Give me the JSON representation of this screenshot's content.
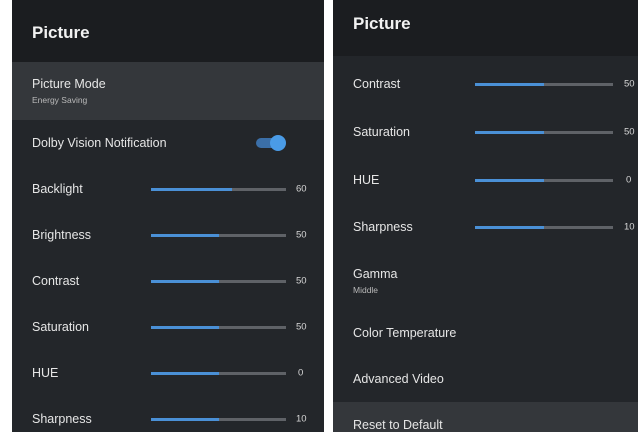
{
  "left": {
    "title": "Picture",
    "picture_mode": {
      "label": "Picture Mode",
      "value": "Energy Saving"
    },
    "dolby": {
      "label": "Dolby Vision Notification",
      "enabled": true
    },
    "sliders": [
      {
        "label": "Backlight",
        "value": "60",
        "level": 0.6
      },
      {
        "label": "Brightness",
        "value": "50",
        "level": 0.5
      },
      {
        "label": "Contrast",
        "value": "50",
        "level": 0.5
      },
      {
        "label": "Saturation",
        "value": "50",
        "level": 0.5
      },
      {
        "label": "HUE",
        "value": "0",
        "level": 0.5
      },
      {
        "label": "Sharpness",
        "value": "10",
        "level": 0.5
      }
    ]
  },
  "right": {
    "title": "Picture",
    "sliders": [
      {
        "label": "Contrast",
        "value": "50",
        "level": 0.5
      },
      {
        "label": "Saturation",
        "value": "50",
        "level": 0.5
      },
      {
        "label": "HUE",
        "value": "0",
        "level": 0.5
      },
      {
        "label": "Sharpness",
        "value": "10",
        "level": 0.5
      }
    ],
    "gamma": {
      "label": "Gamma",
      "value": "Middle"
    },
    "color_temperature": "Color Temperature",
    "advanced_video": "Advanced Video",
    "reset": "Reset to Default"
  },
  "colors": {
    "accent": "#4a90d6",
    "track": "#5f6267",
    "panel": "#23262a",
    "header": "#1b1d20",
    "highlight": "#34373b"
  }
}
